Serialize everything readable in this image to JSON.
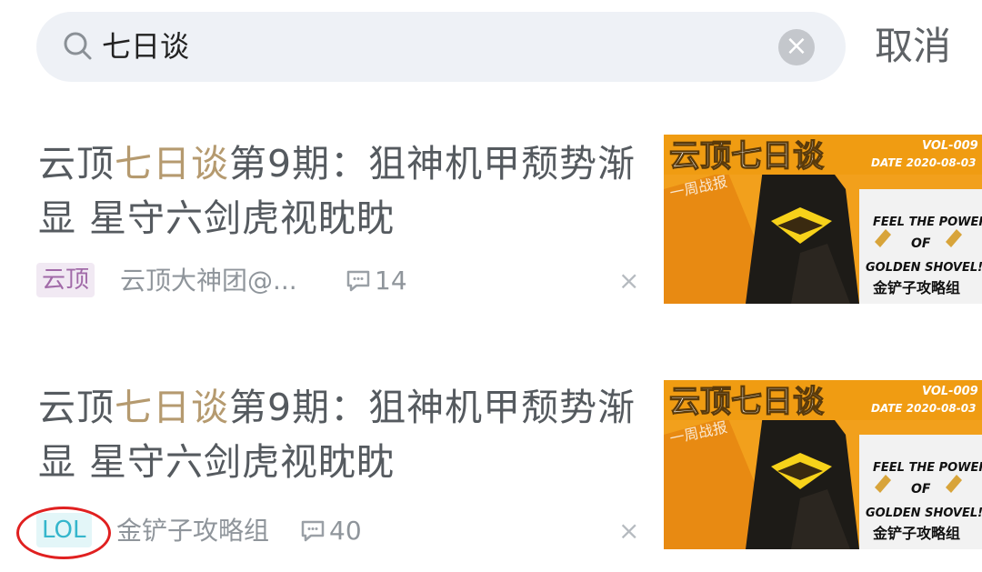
{
  "search": {
    "query": "七日谈",
    "cancel_label": "取消",
    "clear_icon": "close-icon",
    "search_icon": "search-icon"
  },
  "results": [
    {
      "title_prefix": "云顶",
      "title_highlight": "七日谈",
      "title_rest": "第9期：狙神机甲颓势渐显 星守六剑虎视眈眈",
      "tag": "云顶",
      "author": "云顶大神团@...",
      "comments": "14",
      "dismiss": "×",
      "thumb": {
        "headline": "云顶七日谈",
        "vol": "VOL-009",
        "date": "DATE 2020-08-03",
        "side1": "FEEL THE POWER",
        "side2": "OF",
        "side3": "GOLDEN SHOVEL!!!",
        "side4": "金铲子攻略组",
        "stamp": "一周战报"
      }
    },
    {
      "title_prefix": "云顶",
      "title_highlight": "七日谈",
      "title_rest": "第9期：狙神机甲颓势渐显 星守六剑虎视眈眈",
      "tag": "LOL",
      "author": "金铲子攻略组",
      "comments": "40",
      "dismiss": "×",
      "thumb": {
        "headline": "云顶七日谈",
        "vol": "VOL-009",
        "date": "DATE 2020-08-03",
        "side1": "FEEL THE POWER",
        "side2": "OF",
        "side3": "GOLDEN SHOVEL!!!",
        "side4": "金铲子攻略组",
        "stamp": "一周战报"
      }
    }
  ],
  "colors": {
    "highlight": "#b59a6f",
    "tag_purple": "#a16aa8",
    "tag_teal": "#35b6cc",
    "annotation_circle": "#e02020"
  }
}
